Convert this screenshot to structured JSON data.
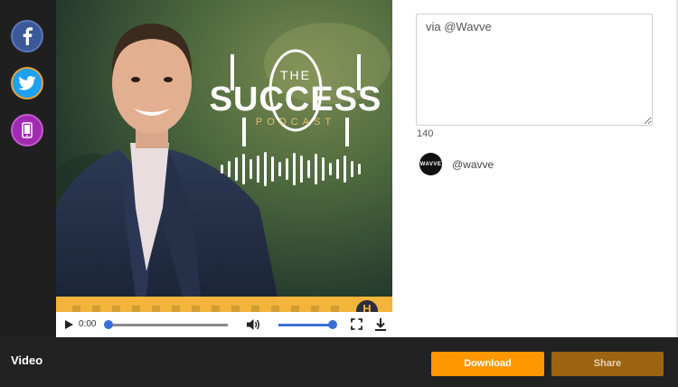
{
  "social": {
    "facebook_icon": "facebook-icon",
    "twitter_icon": "twitter-icon",
    "mobile_icon": "mobile-icon"
  },
  "artwork": {
    "title_small": "THE",
    "title_big": "SUCCESS",
    "title_sub": "PODCAST",
    "badge": "H"
  },
  "player": {
    "time": "0:00",
    "progress": 0,
    "volume": 1
  },
  "composer": {
    "message": "via @Wavve",
    "char_count": "140",
    "avatar_text": "WAVVE",
    "handle": "@wavve"
  },
  "footer": {
    "label": "Video",
    "download_label": "Download",
    "share_label": "Share"
  },
  "colors": {
    "download": "#ff9800",
    "share": "#9c6410",
    "accent": "#3a6fd8"
  }
}
